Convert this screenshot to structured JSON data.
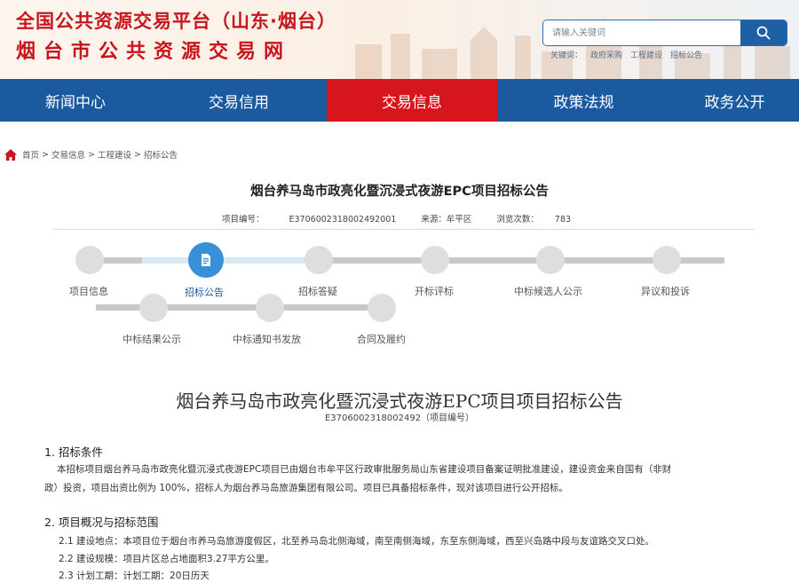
{
  "header": {
    "title_line1": "全国公共资源交易平台（山东·烟台）",
    "title_line2": "烟台市公共资源交易网",
    "search_placeholder": "请输入关键词",
    "keywords_label": "关键词：",
    "keywords": [
      "政府采购",
      "工程建设",
      "招标公告"
    ]
  },
  "nav": {
    "items": [
      {
        "label": "新闻中心",
        "active": false
      },
      {
        "label": "交易信用",
        "active": false
      },
      {
        "label": "交易信息",
        "active": true
      },
      {
        "label": "政策法规",
        "active": false
      },
      {
        "label": "政务公开",
        "active": false
      }
    ]
  },
  "breadcrumb": [
    "首页",
    "交易信息",
    "工程建设",
    "招标公告"
  ],
  "article": {
    "title": "烟台养马岛市政亮化暨沉浸式夜游EPC项目招标公告",
    "project_no_label": "项目编号：",
    "project_no": "E3706002318002492001",
    "source_label": "来源：",
    "source": "牟平区",
    "views_label": "浏览次数：",
    "views": "783"
  },
  "steps": {
    "row1": [
      "项目信息",
      "招标公告",
      "招标答疑",
      "开标评标",
      "中标候选人公示",
      "异议和投诉"
    ],
    "row2": [
      "中标结果公示",
      "中标通知书发放",
      "合同及履约"
    ],
    "active": "招标公告"
  },
  "document": {
    "title": "烟台养马岛市政亮化暨沉浸式夜游EPC项目项目招标公告",
    "subtitle": "E3706002318002492（项目编号）",
    "section1_heading": "1. 招标条件",
    "section1_line1": "本招标项目烟台养马岛市政亮化暨沉浸式夜游EPC项目已由烟台市牟平区行政审批服务局山东省建设项目备案证明批准建设，建设资金来自国有（非财",
    "section1_line2": "政）投资，项目出资比例为 100%，招标人为烟台养马岛旅游集团有限公司。项目已具备招标条件，现对该项目进行公开招标。",
    "section2_heading": "2. 项目概况与招标范围",
    "items": [
      "2.1 建设地点：本项目位于烟台市养马岛旅游度假区，北至养马岛北侧海域，南至南侧海域，东至东侧海域，西至兴岛路中段与友谊路交叉口处。",
      "2.2 建设规模：项目片区总占地面积3.27平方公里。",
      "2.3 计划工期：计划工期：20日历天"
    ]
  },
  "colors": {
    "brand_red": "#c8161d",
    "nav_blue": "#1c5aa0",
    "nav_active_red": "#d6151d",
    "step_active_blue": "#3a8fd9"
  }
}
